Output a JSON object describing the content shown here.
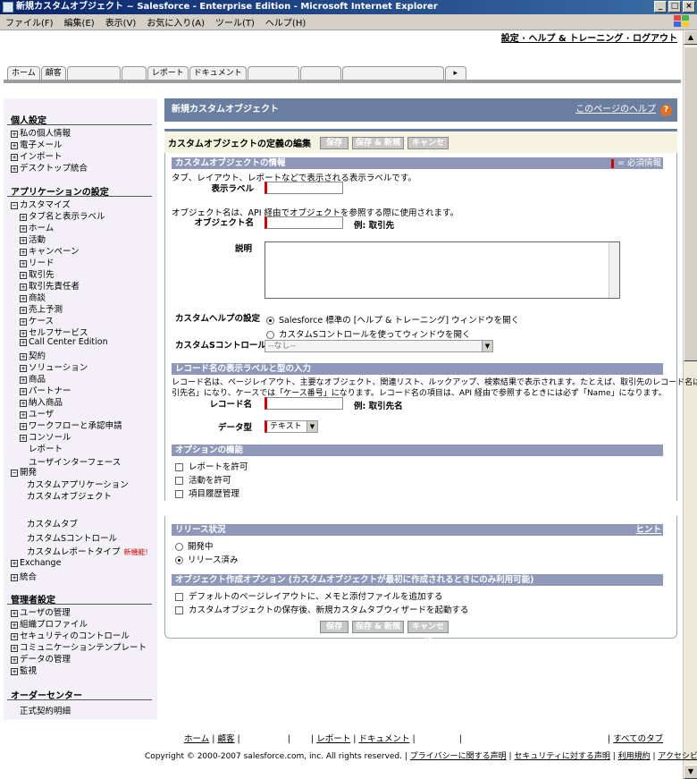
{
  "window": {
    "title": "新規カスタムオブジェクト ~ Salesforce - Enterprise Edition - Microsoft Internet Explorer",
    "min": "_",
    "max": "□",
    "close": "×"
  },
  "menu": [
    "ファイル(F)",
    "編集(E)",
    "表示(V)",
    "お気に入り(A)",
    "ツール(T)",
    "ヘルプ(H)"
  ],
  "top_links": "設定 · ヘルプ & トレーニング · ログアウト",
  "tabs": [
    "ホーム",
    "顧客",
    "",
    "",
    "レポート",
    "ドキュメント",
    "",
    "",
    "",
    "▸"
  ],
  "sidebar": {
    "personal": {
      "title": "個人設定",
      "items": [
        "私の個人情報",
        "電子メール",
        "インポート",
        "デスクトップ統合"
      ]
    },
    "app": {
      "title": "アプリケーションの設定",
      "customize": "カスタマイズ",
      "customize_items": [
        "タブ名と表示ラベル",
        "ホーム",
        "活動",
        "キャンペーン",
        "リード",
        "取引先",
        "取引先責任者",
        "商談",
        "売上予測",
        "ケース",
        "セルフサービス",
        "Call Center Edition",
        "契約",
        "ソリューション",
        "商品",
        "パートナー",
        "納入商品",
        "ユーザ",
        "ワークフローと承認申請",
        "コンソール"
      ],
      "plain_items": [
        "レポート",
        "ユーザインターフェース"
      ],
      "develop": "開発",
      "develop_items": [
        "カスタムアプリケーション",
        "カスタムオブジェクト",
        "カスタムタブ",
        "カスタムSコントロール",
        "カスタムレポートタイプ"
      ],
      "new_badge": "新機能!",
      "exchange": "Exchange",
      "integrate": "統合"
    },
    "admin": {
      "title": "管理者設定",
      "items": [
        "ユーザの管理",
        "組織プロファイル",
        "セキュリティのコントロール",
        "コミュニケーションテンプレート",
        "データの管理",
        "監視"
      ]
    },
    "order": {
      "title": "オーダーセンター",
      "item": "正式契約明細"
    }
  },
  "page": {
    "title": "新規カスタムオブジェクト",
    "help": "このページのヘルプ",
    "edit_title": "カスタムオブジェクトの定義の編集",
    "buttons": {
      "save": "保存",
      "save_new": "保存 & 新規",
      "cancel": "キャンセル"
    }
  },
  "info_section": {
    "title": "カスタムオブジェクトの情報",
    "required_legend": "= 必須情報",
    "label_desc": "タブ、レイアウト、レポートなどで表示される表示ラベルです。",
    "label": "表示ラベル",
    "name_desc": "オブジェクト名は、API 経由でオブジェクトを参照する際に使用されます。",
    "object_name": "オブジェクト名",
    "object_example": "例:  取引先",
    "description": "説明",
    "help_setting": "カスタムヘルプの設定",
    "help_opt1": "Salesforce 標準の [ヘルプ & トレーニング] ウィンドウを開く",
    "help_opt2": "カスタムSコントロールを使ってウィンドウを開く",
    "scontrol_label": "カスタムSコントロール",
    "scontrol_value": "--なし--"
  },
  "record_section": {
    "title": "レコード名の表示ラベルと型の入力",
    "desc1": "レコード名は、ページレイアウト、主要なオブジェクト、関連リスト、ルックアップ、検索結果で表示されます。たとえば、取引先のレコード名は「取",
    "desc2": "引先名」になり、ケースでは「ケース番号」になります。レコード名の項目は、API 経由で参照するときには必ず「Name」になります。",
    "record_name": "レコード名",
    "record_example": "例:  取引先名",
    "data_type": "データ型",
    "data_type_value": "テキスト"
  },
  "options_section": {
    "title": "オプションの機能",
    "items": [
      "レポートを許可",
      "活動を許可",
      "項目履歴管理"
    ]
  },
  "release_section": {
    "title": "リリース状況",
    "hint": "ヒント",
    "options": [
      "開発中",
      "リリース済み"
    ]
  },
  "creation_section": {
    "title": "オブジェクト作成オプション (カスタムオブジェクトが最初に作成されるときにのみ利用可能)",
    "items": [
      "デフォルトのページレイアウトに、メモと添付ファイルを追加する",
      "カスタムオブジェクトの保存後、新規カスタムタブウィザードを起動する"
    ]
  },
  "footer": {
    "links": [
      "ホーム",
      "顧客",
      "",
      "",
      "レポート",
      "ドキュメント",
      "",
      "",
      "すべてのタブ"
    ],
    "copyright": "Copyright © 2000-2007 salesforce.com, inc. All rights reserved.",
    "legal": [
      "プライバシーに関する声明",
      "セキュリティに対する声明",
      "利用規約",
      "アクセシビリティ"
    ]
  },
  "colors": {
    "header": "#6a7fa0",
    "section": "#8f98b8",
    "required": "#cc0000",
    "sidebar_bg": "#f3f1f7"
  }
}
